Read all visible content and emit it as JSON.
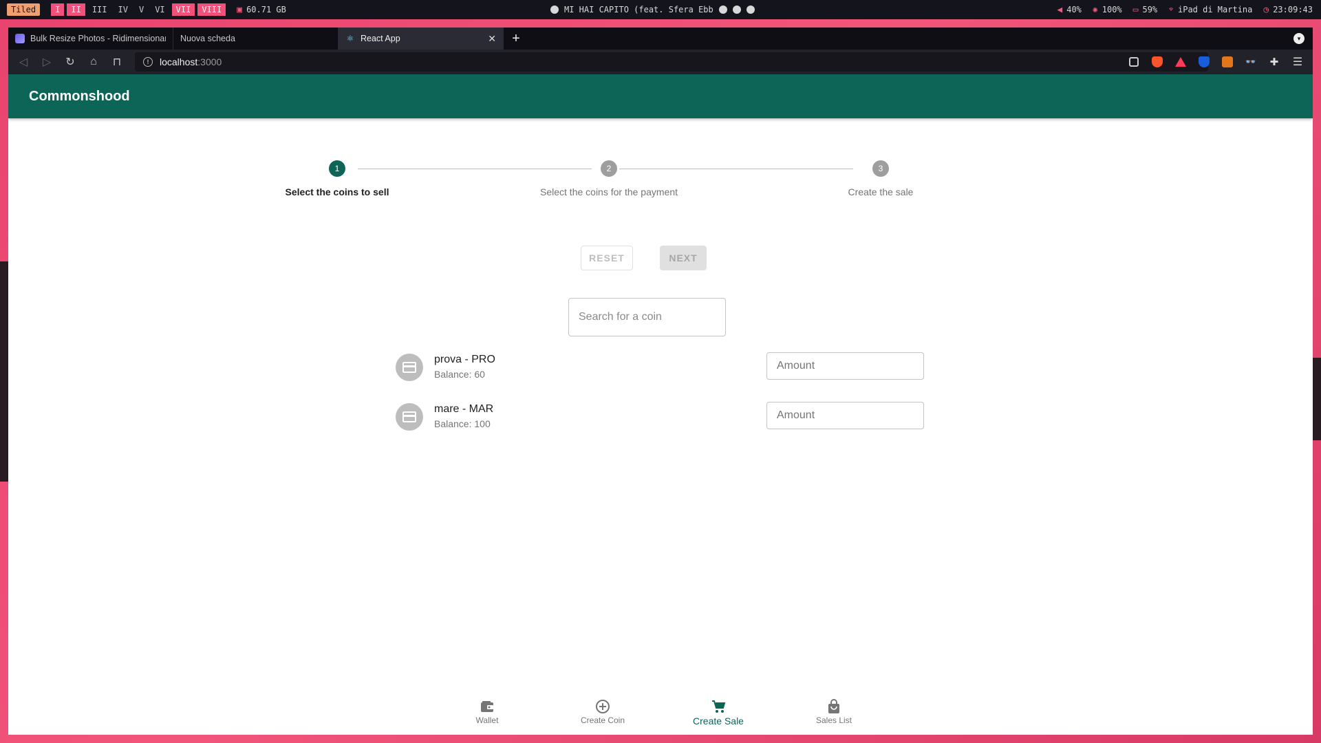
{
  "sysbar": {
    "layout": "Tiled",
    "workspaces": [
      "I",
      "II",
      "III",
      "IV",
      "V",
      "VI",
      "VII",
      "VIII"
    ],
    "disk": "60.71 GB",
    "track": "MI HAI CAPITO (feat. Sfera Ebb",
    "volume": "40%",
    "brightness": "100%",
    "battery": "59%",
    "wifi": "iPad di Martina",
    "clock": "23:09:43"
  },
  "browser": {
    "tabs": [
      {
        "title": "Bulk Resize Photos - Ridimensionare",
        "active": false
      },
      {
        "title": "Nuova scheda",
        "active": false
      },
      {
        "title": "React App",
        "active": true
      }
    ],
    "url_host": "localhost",
    "url_port": ":3000"
  },
  "app": {
    "title": "Commonshood",
    "steps": [
      {
        "number": "1",
        "label": "Select the coins to sell",
        "active": true
      },
      {
        "number": "2",
        "label": "Select the coins for the payment",
        "active": false
      },
      {
        "number": "3",
        "label": "Create the sale",
        "active": false
      }
    ],
    "reset_label": "RESET",
    "next_label": "NEXT",
    "search_placeholder": "Search for a coin",
    "coins": [
      {
        "name": "prova - PRO",
        "balance": "Balance: 60",
        "amount_placeholder": "Amount"
      },
      {
        "name": "mare - MAR",
        "balance": "Balance: 100",
        "amount_placeholder": "Amount"
      }
    ],
    "nav": [
      {
        "label": "Wallet",
        "icon": "wallet-icon",
        "active": false
      },
      {
        "label": "Create Coin",
        "icon": "add-circle-icon",
        "active": false
      },
      {
        "label": "Create Sale",
        "icon": "cart-icon",
        "active": true
      },
      {
        "label": "Sales List",
        "icon": "shopping-bag-icon",
        "active": false
      }
    ],
    "colors": {
      "primary": "#0d6557",
      "inactive": "#9e9e9e"
    }
  }
}
